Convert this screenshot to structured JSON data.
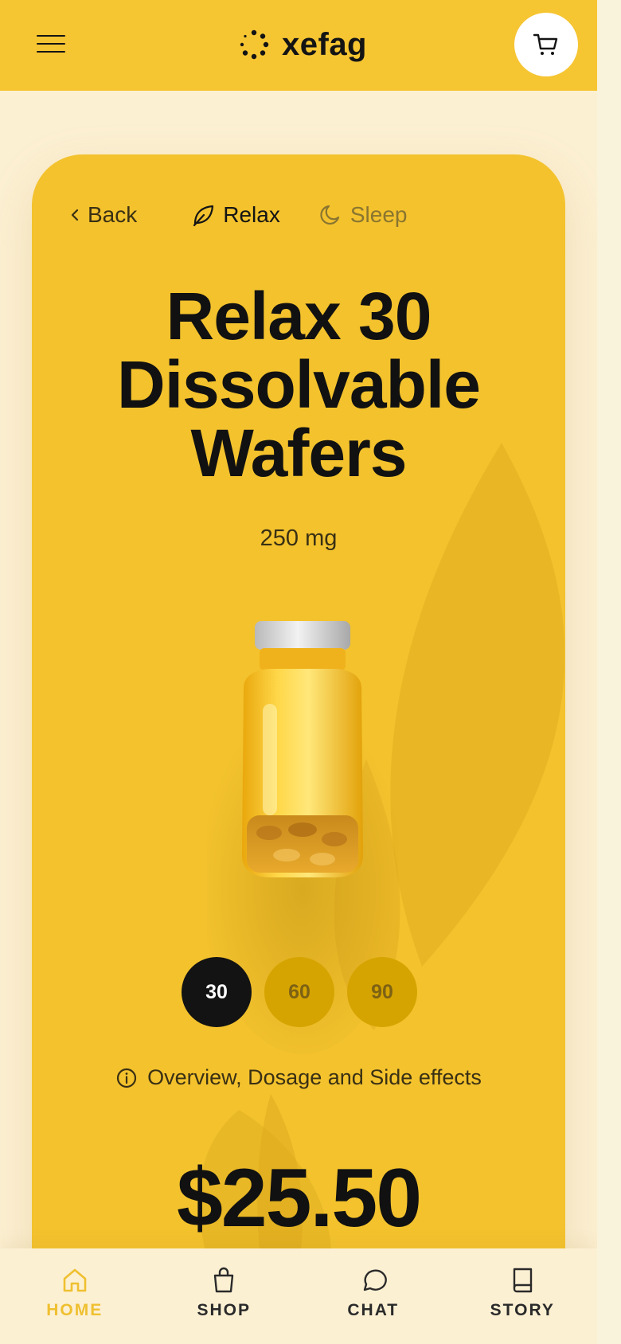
{
  "header": {
    "brand": "xefag",
    "menu_icon": "hamburger-icon",
    "cart_icon": "cart-icon"
  },
  "product_nav": {
    "back_label": "Back",
    "categories": [
      {
        "label": "Relax",
        "icon": "leaf-icon",
        "active": true
      },
      {
        "label": "Sleep",
        "icon": "moon-icon",
        "active": false
      }
    ]
  },
  "product": {
    "title_lines": [
      "Relax 30",
      "Dissolvable",
      "Wafers"
    ],
    "dosage": "250 mg",
    "pack_options": [
      "30",
      "60",
      "90"
    ],
    "selected_pack": "30",
    "info_link": "Overview, Dosage and Side effects",
    "price": "$25.50"
  },
  "bottom_nav": {
    "tabs": [
      {
        "label": "HOME",
        "icon": "home-icon",
        "active": true
      },
      {
        "label": "SHOP",
        "icon": "shopping-bag-icon",
        "active": false
      },
      {
        "label": "CHAT",
        "icon": "chat-bubble-icon",
        "active": false
      },
      {
        "label": "STORY",
        "icon": "book-icon",
        "active": false
      }
    ]
  },
  "colors": {
    "brand_yellow": "#f6c532",
    "card_yellow": "#f3c22d",
    "background_cream": "#fcf0d3",
    "active_tab": "#efc030",
    "pill_active": "#131313",
    "pill_inactive": "#d6a400"
  }
}
